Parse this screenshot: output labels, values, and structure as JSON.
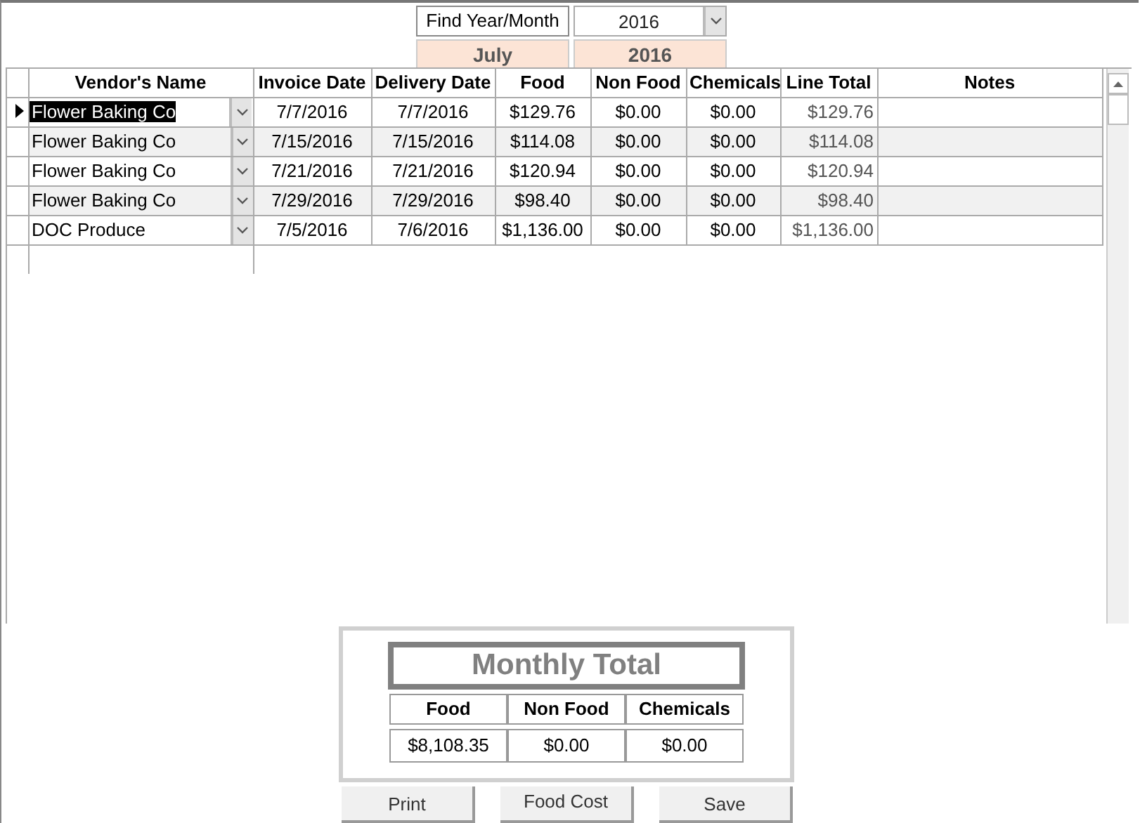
{
  "filter": {
    "label": "Find Year/Month",
    "year_value": "2016",
    "month_display": "July",
    "year_display": "2016"
  },
  "grid": {
    "columns": [
      "Vendor's Name",
      "Invoice Date",
      "Delivery Date",
      "Food",
      "Non Food",
      "Chemicals",
      "Line Total",
      "Notes"
    ],
    "rows": [
      {
        "vendor": "Flower Baking Co",
        "invoice_date": "7/7/2016",
        "delivery_date": "7/7/2016",
        "food": "$129.76",
        "non_food": "$0.00",
        "chemicals": "$0.00",
        "line_total": "$129.76",
        "selected": true
      },
      {
        "vendor": "Flower Baking Co",
        "invoice_date": "7/15/2016",
        "delivery_date": "7/15/2016",
        "food": "$114.08",
        "non_food": "$0.00",
        "chemicals": "$0.00",
        "line_total": "$114.08",
        "selected": false
      },
      {
        "vendor": "Flower Baking Co",
        "invoice_date": "7/21/2016",
        "delivery_date": "7/21/2016",
        "food": "$120.94",
        "non_food": "$0.00",
        "chemicals": "$0.00",
        "line_total": "$120.94",
        "selected": false
      },
      {
        "vendor": "Flower Baking Co",
        "invoice_date": "7/29/2016",
        "delivery_date": "7/29/2016",
        "food": "$98.40",
        "non_food": "$0.00",
        "chemicals": "$0.00",
        "line_total": "$98.40",
        "selected": false
      },
      {
        "vendor": "DOC Produce",
        "invoice_date": "7/5/2016",
        "delivery_date": "7/6/2016",
        "food": "$1,136.00",
        "non_food": "$0.00",
        "chemicals": "$0.00",
        "line_total": "$1,136.00",
        "selected": false
      }
    ]
  },
  "monthly_total": {
    "title": "Monthly Total",
    "columns": [
      "Food",
      "Non Food",
      "Chemicals"
    ],
    "values": [
      "$8,108.35",
      "$0.00",
      "$0.00"
    ]
  },
  "buttons": [
    "Print",
    "Food Cost",
    "Save"
  ]
}
